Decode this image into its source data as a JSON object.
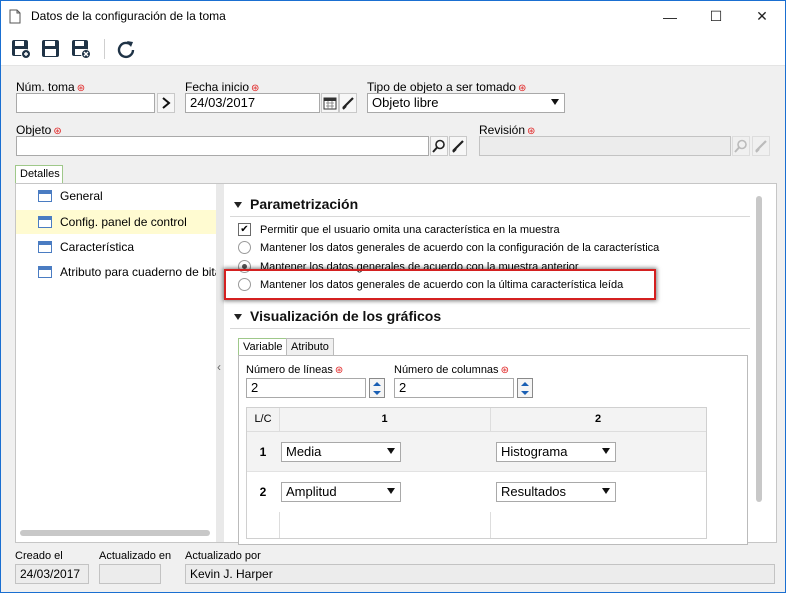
{
  "window": {
    "title": "Datos de la configuración de la toma",
    "minimize": "—",
    "maximize": "☐",
    "close": "✕"
  },
  "toolbar": {
    "save_new": "save-new-icon",
    "save": "save-icon",
    "save_close": "save-close-icon",
    "refresh": "refresh-icon"
  },
  "header": {
    "num_toma_label": "Núm. toma",
    "num_toma_value": "",
    "fecha_inicio_label": "Fecha inicio",
    "fecha_inicio_value": "24/03/2017",
    "tipo_objeto_label": "Tipo de objeto a ser tomado",
    "tipo_objeto_value": "Objeto libre",
    "objeto_label": "Objeto",
    "objeto_value": "",
    "revision_label": "Revisión",
    "revision_value": "",
    "required_mark": "⊛"
  },
  "tabs": {
    "detalles": "Detalles"
  },
  "sidebar": {
    "items": [
      {
        "label": "General"
      },
      {
        "label": "Config. panel de control"
      },
      {
        "label": "Característica"
      },
      {
        "label": "Atributo para cuaderno de bitác"
      }
    ],
    "collapse_glyph": "‹"
  },
  "parametrizacion": {
    "title": "Parametrización",
    "options": [
      "Permitir que el usuario omita una característica en la muestra",
      "Mantener los datos generales de acuerdo con la configuración de la característica",
      "Mantener los datos generales de acuerdo con la muestra anterior",
      "Mantener los datos generales de acuerdo con la última característica leída"
    ],
    "checkbox_checked": true,
    "checkbox_mark": "✔",
    "selected_radio": 1
  },
  "graficos": {
    "title": "Visualización de los gráficos",
    "subtabs": [
      "Variable",
      "Atributo"
    ],
    "num_lineas_label": "Número de líneas",
    "num_lineas_value": "2",
    "num_columnas_label": "Número de columnas",
    "num_columnas_value": "2",
    "table": {
      "corner": "L/C",
      "col_headers": [
        "1",
        "2"
      ],
      "rows": [
        {
          "label": "1",
          "cells": [
            "Media",
            "Histograma"
          ]
        },
        {
          "label": "2",
          "cells": [
            "Amplitud",
            "Resultados"
          ]
        }
      ]
    }
  },
  "footer": {
    "creado_label": "Creado el",
    "creado_value": "24/03/2017",
    "actualizado_en_label": "Actualizado en",
    "actualizado_en_value": "",
    "actualizado_por_label": "Actualizado por",
    "actualizado_por_value": "Kevin J. Harper"
  },
  "colors": {
    "accent": "#1a6fd1",
    "highlight": "#d42020",
    "active_nav": "#fffbd1"
  }
}
